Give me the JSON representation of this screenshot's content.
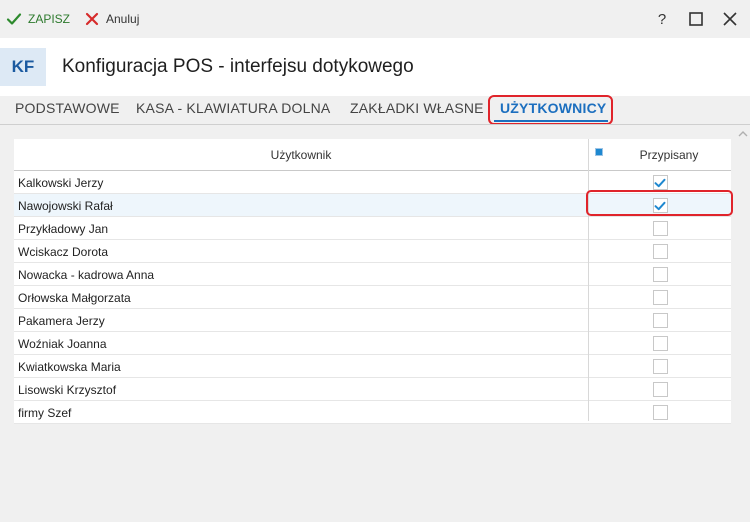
{
  "toolbar": {
    "save_label": "ZAPISZ",
    "cancel_label": "Anuluj",
    "help_label": "?"
  },
  "header": {
    "badge": "KF",
    "title": "Konfiguracja POS - interfejsu dotykowego"
  },
  "tabs": [
    {
      "label": "PODSTAWOWE",
      "active": false
    },
    {
      "label": "KASA - KLAWIATURA DOLNA",
      "active": false
    },
    {
      "label": "ZAKŁADKI WŁASNE",
      "active": false
    },
    {
      "label": "UŻYTKOWNICY",
      "active": true
    }
  ],
  "grid": {
    "columns": [
      "Użytkownik",
      "Przypisany"
    ],
    "rows": [
      {
        "name": "Kalkowski Jerzy",
        "assigned": true
      },
      {
        "name": "Nawojowski Rafał",
        "assigned": true
      },
      {
        "name": "Przykładowy Jan",
        "assigned": false
      },
      {
        "name": "Wciskacz Dorota",
        "assigned": false
      },
      {
        "name": "Nowacka - kadrowa Anna",
        "assigned": false
      },
      {
        "name": "Orłowska Małgorzata",
        "assigned": false
      },
      {
        "name": "Pakamera Jerzy",
        "assigned": false
      },
      {
        "name": "Woźniak Joanna",
        "assigned": false
      },
      {
        "name": "Kwiatkowska Maria",
        "assigned": false
      },
      {
        "name": "Lisowski Krzysztof",
        "assigned": false
      },
      {
        "name": "firmy Szef",
        "assigned": false
      }
    ]
  },
  "colors": {
    "accent": "#1c6fbf",
    "highlight": "#e0242b",
    "check": "#1e88d0"
  }
}
